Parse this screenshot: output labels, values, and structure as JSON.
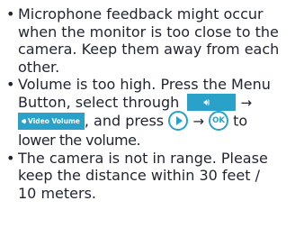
{
  "bullet_char": "•",
  "items": [
    {
      "lines": [
        "Microphone feedback might occur",
        "when the monitor is too close to the",
        "camera. Keep them away from each",
        "other."
      ]
    },
    {
      "line1": "Volume is too high. Press the Menu",
      "line2_text": "Button, select through",
      "arrow": "→",
      "video_volume_label": "Video Volume",
      "press_text": ", and press",
      "ok_label": "OK",
      "to_text": "to",
      "line4": "lower the volume."
    },
    {
      "lines": [
        "The camera is not in range. Please",
        "keep the distance within 30 feet /",
        "10 meters."
      ]
    }
  ],
  "icons": {
    "speaker": "speaker-icon",
    "play": "play-button-icon",
    "ok": "ok-button-icon"
  },
  "colors": {
    "accent": "#2aa1c9",
    "text": "#1f2430"
  }
}
